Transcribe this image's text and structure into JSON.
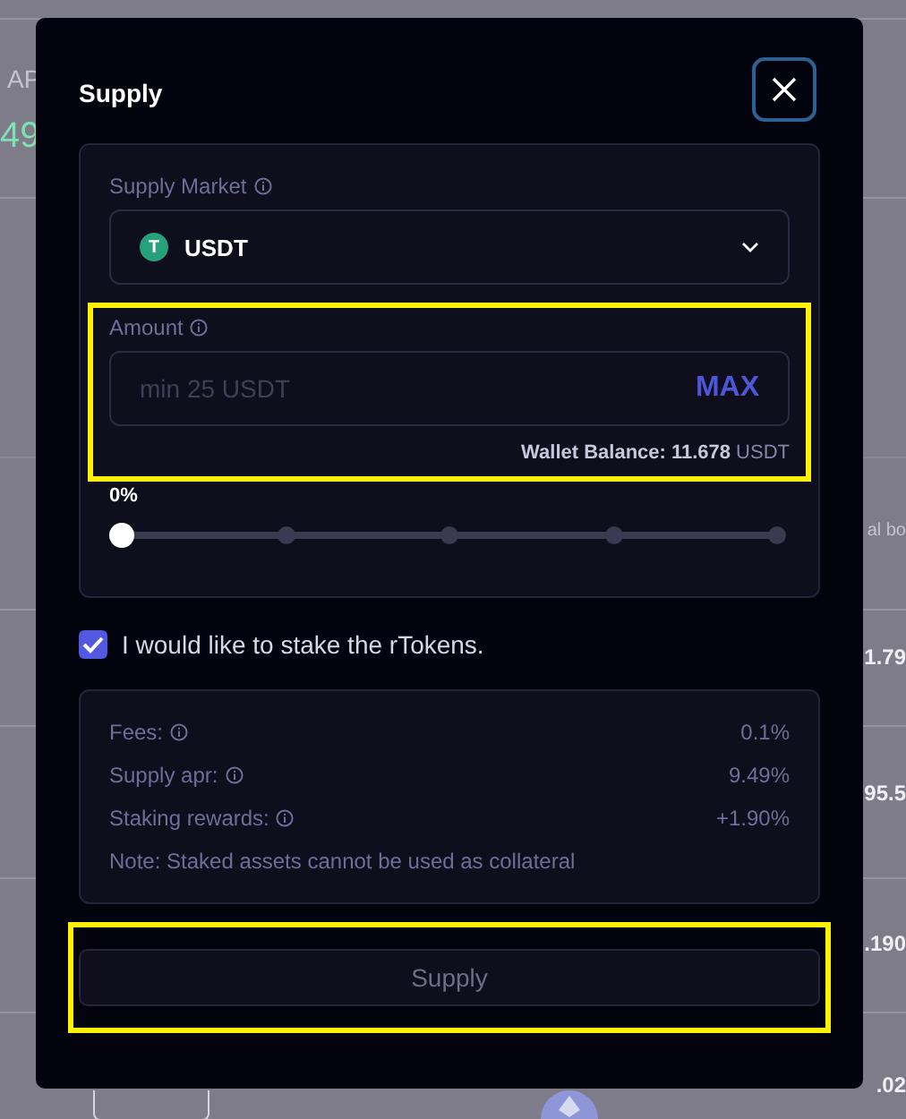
{
  "background": {
    "rows": [
      {
        "left": [],
        "right": []
      },
      {
        "left": [
          {
            "text": "AP",
            "kind": "label"
          },
          {
            "text": "49",
            "kind": "positive"
          }
        ],
        "right": []
      },
      {
        "left": [],
        "right": []
      },
      {
        "left": [],
        "right": [
          {
            "text": "al bo",
            "kind": "label"
          }
        ]
      },
      {
        "left": [],
        "right": [
          {
            "text": "1.79",
            "kind": "value"
          }
        ]
      },
      {
        "left": [],
        "right": [
          {
            "text": "95.5",
            "kind": "value"
          }
        ]
      },
      {
        "left": [],
        "right": [
          {
            "text": ".190",
            "kind": "value"
          }
        ]
      },
      {
        "left": [],
        "right": [
          {
            "text": ".02",
            "kind": "value"
          }
        ],
        "has_actions": true
      }
    ]
  },
  "dialog": {
    "title": "Supply",
    "market": {
      "label": "Supply Market",
      "value": "USDT",
      "token_symbol": "T"
    },
    "amount": {
      "label": "Amount",
      "placeholder": "min 25 USDT",
      "max": "MAX",
      "balance_label": "Wallet Balance: 11.678",
      "balance_unit": "USDT",
      "highlighted": true
    },
    "slider": {
      "reading": "0%",
      "level": 0
    },
    "stake": {
      "label": "I would like to stake the rTokens.",
      "checked": true
    },
    "details": [
      {
        "label": "Fees:",
        "value": "0.1%",
        "info": true
      },
      {
        "label": "Supply apr:",
        "value": "9.49%",
        "info": true
      },
      {
        "label": "Staking rewards:",
        "value": "+1.90%",
        "info": true
      }
    ],
    "note": "Note: Staked assets cannot be used as collateral",
    "submit": {
      "label": "Supply",
      "disabled": true,
      "highlighted": true
    }
  }
}
